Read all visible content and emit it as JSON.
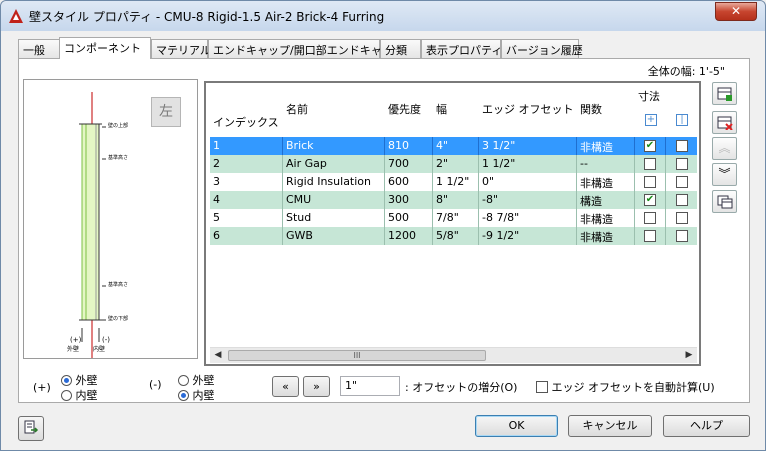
{
  "window": {
    "title": "壁スタイル プロパティ - CMU-8 Rigid-1.5 Air-2 Brick-4 Furring",
    "close_label": "✕"
  },
  "tabs": [
    {
      "label": "一般",
      "active": false
    },
    {
      "label": "コンポーネント",
      "active": true
    },
    {
      "label": "マテリアル",
      "active": false
    },
    {
      "label": "エンドキャップ/開口部エンドキャップ",
      "active": false
    },
    {
      "label": "分類",
      "active": false
    },
    {
      "label": "表示プロパティ",
      "active": false
    },
    {
      "label": "バージョン履歴",
      "active": false
    }
  ],
  "total_width": "全体の幅: 1'-5\"",
  "preview": {
    "left_button": "左",
    "labels": [
      "壁の上部",
      "基準高さ",
      "基準高さ",
      "壁の下部"
    ],
    "bottom_left": "(+)",
    "bottom_left2": "外壁",
    "bottom_right": "(-)",
    "bottom_right2": "内壁"
  },
  "grid": {
    "headers": {
      "index": "インデックス",
      "name": "名前",
      "priority": "優先度",
      "width": "幅",
      "edge_offset": "エッジ オフセット",
      "function": "関数",
      "dimension": "寸法"
    },
    "rows": [
      {
        "index": "1",
        "name": "Brick",
        "priority": "810",
        "width": "4\"",
        "offset": "3 1/2\"",
        "function": "非構造",
        "dim1": true,
        "dim2": false
      },
      {
        "index": "2",
        "name": "Air Gap",
        "priority": "700",
        "width": "2\"",
        "offset": "1 1/2\"",
        "function": "--",
        "dim1": false,
        "dim2": false
      },
      {
        "index": "3",
        "name": "Rigid Insulation",
        "priority": "600",
        "width": "1 1/2\"",
        "offset": "0\"",
        "function": "非構造",
        "dim1": false,
        "dim2": false
      },
      {
        "index": "4",
        "name": "CMU",
        "priority": "300",
        "width": "8\"",
        "offset": "-8\"",
        "function": "構造",
        "dim1": true,
        "dim2": false
      },
      {
        "index": "5",
        "name": "Stud",
        "priority": "500",
        "width": "7/8\"",
        "offset": "-8 7/8\"",
        "function": "非構造",
        "dim1": false,
        "dim2": false
      },
      {
        "index": "6",
        "name": "GWB",
        "priority": "1200",
        "width": "5/8\"",
        "offset": "-9 1/2\"",
        "function": "非構造",
        "dim1": false,
        "dim2": false
      }
    ],
    "scrollbar_grip": "III"
  },
  "side_buttons": [
    "add-component",
    "delete-component",
    "move-up",
    "move-down",
    "copy-component"
  ],
  "bottom": {
    "plus_label": "(+)",
    "minus_label": "(-)",
    "plus_options": [
      {
        "label": "外壁",
        "checked": true
      },
      {
        "label": "内壁",
        "checked": false
      }
    ],
    "minus_options": [
      {
        "label": "外壁",
        "checked": false
      },
      {
        "label": "内壁",
        "checked": true
      }
    ],
    "increment_value": "1\"",
    "increment_label": ": オフセットの増分(O)",
    "auto_calc_label": "エッジ オフセットを自動計算(U)",
    "prev_label": "«",
    "next_label": "»"
  },
  "buttons": {
    "ok": "OK",
    "cancel": "キャンセル",
    "help": "ヘルプ"
  },
  "colors": {
    "selected": "#3399ff",
    "alt_row": "#c6e6d6",
    "wall_line": "#c00000",
    "wall_fill": "#d4f0a0"
  }
}
